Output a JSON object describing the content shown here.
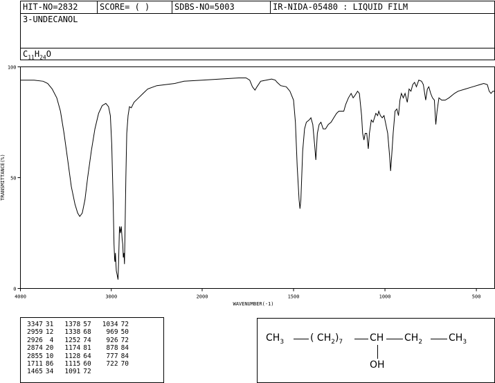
{
  "header": {
    "hit_no": "HIT-NO=2832",
    "score": "SCORE=  (   )",
    "sdbs_no": "SDBS-NO=5003",
    "ir_info": "IR-NIDA-05480 : LIQUID FILM",
    "compound_name": "3-UNDECANOL",
    "formula": {
      "c": "C",
      "c_n": "11",
      "h": "H",
      "h_n": "24",
      "o": "O"
    }
  },
  "chart_data": {
    "type": "line",
    "title": "",
    "xlabel": "WAVENUMBER(-1)",
    "ylabel": "TRANSMITTANCE(%)",
    "xlim": [
      4000,
      400
    ],
    "ylim": [
      0,
      100
    ],
    "x_ticks": [
      4000,
      3000,
      2000,
      1500,
      1000,
      500
    ],
    "y_ticks": [
      0,
      50,
      100
    ],
    "grid": false,
    "series": [
      {
        "color": "#000000",
        "points": [
          [
            4000,
            94
          ],
          [
            3850,
            94
          ],
          [
            3750,
            93.5
          ],
          [
            3700,
            92.5
          ],
          [
            3650,
            90
          ],
          [
            3600,
            86
          ],
          [
            3560,
            80
          ],
          [
            3520,
            70
          ],
          [
            3480,
            58
          ],
          [
            3440,
            46
          ],
          [
            3400,
            38
          ],
          [
            3370,
            34
          ],
          [
            3347,
            32.5
          ],
          [
            3320,
            34
          ],
          [
            3290,
            40
          ],
          [
            3260,
            50
          ],
          [
            3220,
            62
          ],
          [
            3180,
            72
          ],
          [
            3140,
            79
          ],
          [
            3100,
            82.5
          ],
          [
            3060,
            83.5
          ],
          [
            3030,
            82
          ],
          [
            3010,
            78
          ],
          [
            2995,
            65
          ],
          [
            2980,
            40
          ],
          [
            2970,
            20
          ],
          [
            2963,
            13
          ],
          [
            2959,
            12
          ],
          [
            2955,
            16
          ],
          [
            2950,
            12
          ],
          [
            2945,
            8
          ],
          [
            2935,
            6
          ],
          [
            2926,
            4
          ],
          [
            2920,
            12
          ],
          [
            2910,
            28
          ],
          [
            2900,
            25
          ],
          [
            2890,
            28
          ],
          [
            2880,
            22
          ],
          [
            2874,
            20
          ],
          [
            2868,
            14
          ],
          [
            2860,
            16
          ],
          [
            2855,
            11
          ],
          [
            2850,
            22
          ],
          [
            2840,
            50
          ],
          [
            2830,
            70
          ],
          [
            2815,
            78
          ],
          [
            2800,
            82
          ],
          [
            2780,
            81.5
          ],
          [
            2750,
            84
          ],
          [
            2700,
            86
          ],
          [
            2650,
            88
          ],
          [
            2600,
            90
          ],
          [
            2500,
            91.5
          ],
          [
            2400,
            92
          ],
          [
            2300,
            92.5
          ],
          [
            2200,
            93.5
          ],
          [
            2000,
            94
          ],
          [
            1900,
            94.5
          ],
          [
            1800,
            95
          ],
          [
            1760,
            95
          ],
          [
            1740,
            94
          ],
          [
            1725,
            91
          ],
          [
            1711,
            89.5
          ],
          [
            1700,
            91
          ],
          [
            1680,
            93.5
          ],
          [
            1650,
            94
          ],
          [
            1620,
            94.5
          ],
          [
            1600,
            94
          ],
          [
            1590,
            93
          ],
          [
            1570,
            91.5
          ],
          [
            1540,
            91
          ],
          [
            1520,
            89
          ],
          [
            1500,
            85
          ],
          [
            1490,
            75
          ],
          [
            1480,
            55
          ],
          [
            1470,
            40
          ],
          [
            1465,
            36
          ],
          [
            1460,
            40
          ],
          [
            1450,
            62
          ],
          [
            1440,
            72
          ],
          [
            1430,
            75
          ],
          [
            1415,
            76
          ],
          [
            1405,
            77
          ],
          [
            1395,
            74
          ],
          [
            1385,
            65
          ],
          [
            1378,
            58
          ],
          [
            1370,
            70
          ],
          [
            1360,
            74
          ],
          [
            1350,
            75
          ],
          [
            1338,
            72
          ],
          [
            1325,
            72
          ],
          [
            1310,
            74
          ],
          [
            1295,
            75
          ],
          [
            1280,
            77
          ],
          [
            1265,
            79
          ],
          [
            1252,
            80
          ],
          [
            1240,
            80
          ],
          [
            1225,
            80
          ],
          [
            1215,
            83
          ],
          [
            1200,
            86
          ],
          [
            1185,
            88
          ],
          [
            1174,
            86
          ],
          [
            1165,
            87
          ],
          [
            1150,
            89
          ],
          [
            1140,
            88
          ],
          [
            1128,
            78
          ],
          [
            1122,
            70
          ],
          [
            1115,
            67
          ],
          [
            1108,
            70
          ],
          [
            1100,
            70
          ],
          [
            1091,
            63
          ],
          [
            1085,
            70
          ],
          [
            1075,
            76
          ],
          [
            1065,
            75
          ],
          [
            1050,
            79
          ],
          [
            1040,
            78
          ],
          [
            1034,
            80
          ],
          [
            1025,
            78
          ],
          [
            1015,
            77
          ],
          [
            1005,
            78
          ],
          [
            995,
            74
          ],
          [
            985,
            70
          ],
          [
            975,
            60
          ],
          [
            969,
            53
          ],
          [
            963,
            60
          ],
          [
            955,
            70
          ],
          [
            945,
            80
          ],
          [
            935,
            81
          ],
          [
            926,
            78
          ],
          [
            918,
            85
          ],
          [
            910,
            88
          ],
          [
            900,
            86
          ],
          [
            890,
            88
          ],
          [
            878,
            84
          ],
          [
            868,
            90
          ],
          [
            858,
            89
          ],
          [
            848,
            92
          ],
          [
            838,
            93
          ],
          [
            828,
            91
          ],
          [
            815,
            94
          ],
          [
            800,
            93.5
          ],
          [
            790,
            92
          ],
          [
            777,
            85
          ],
          [
            768,
            90
          ],
          [
            760,
            91
          ],
          [
            750,
            88
          ],
          [
            740,
            86
          ],
          [
            730,
            85
          ],
          [
            722,
            74
          ],
          [
            715,
            80
          ],
          [
            705,
            86
          ],
          [
            690,
            85
          ],
          [
            670,
            85
          ],
          [
            650,
            86
          ],
          [
            620,
            88
          ],
          [
            600,
            89
          ],
          [
            560,
            90
          ],
          [
            520,
            91
          ],
          [
            480,
            92
          ],
          [
            460,
            92.5
          ],
          [
            440,
            92
          ],
          [
            430,
            89
          ],
          [
            420,
            88
          ],
          [
            410,
            89
          ],
          [
            400,
            89
          ]
        ]
      }
    ]
  },
  "peak_table": {
    "columns": [
      [
        [
          "3347",
          "31"
        ],
        [
          "2959",
          "12"
        ],
        [
          "2926",
          "4"
        ],
        [
          "2874",
          "20"
        ],
        [
          "2855",
          "10"
        ],
        [
          "1711",
          "86"
        ],
        [
          "1465",
          "34"
        ]
      ],
      [
        [
          "1378",
          "57"
        ],
        [
          "1338",
          "68"
        ],
        [
          "1252",
          "74"
        ],
        [
          "1174",
          "81"
        ],
        [
          "1128",
          "64"
        ],
        [
          "1115",
          "60"
        ],
        [
          "1091",
          "72"
        ]
      ],
      [
        [
          "1034",
          "72"
        ],
        [
          "969",
          "50"
        ],
        [
          "926",
          "72"
        ],
        [
          "878",
          "84"
        ],
        [
          "777",
          "84"
        ],
        [
          "722",
          "70"
        ]
      ]
    ]
  },
  "structure": {
    "ch3_left": "CH",
    "ch3_left_sub": "3",
    "paren_open": "( CH",
    "ch2_sub": "2",
    "paren_close": ")",
    "repeat_n": "7",
    "ch": "CH",
    "ch2": "CH",
    "ch2b_sub": "2",
    "ch3_right": "CH",
    "ch3_right_sub": "3",
    "oh": "OH"
  }
}
